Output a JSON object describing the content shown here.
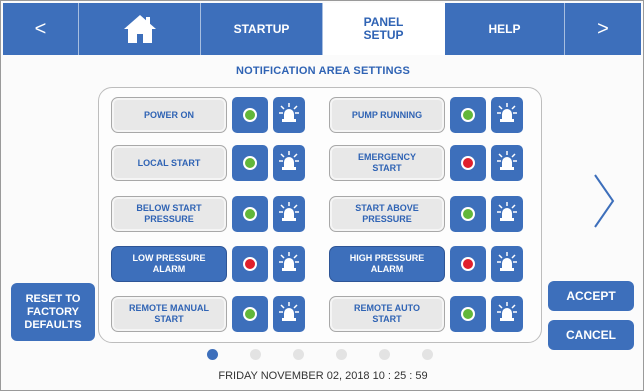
{
  "nav": {
    "back_icon": "chevron-left-icon",
    "back_glyph": "<",
    "home_icon": "home-icon",
    "startup_label": "STARTUP",
    "panel_setup_label": "PANEL\nSETUP",
    "help_label": "HELP",
    "next_icon": "chevron-right-icon",
    "next_glyph": ">"
  },
  "section_title": "NOTIFICATION AREA SETTINGS",
  "rows": [
    {
      "label": "POWER ON",
      "status": "green",
      "style": "normal"
    },
    {
      "label": "PUMP RUNNING",
      "status": "green",
      "style": "normal"
    },
    {
      "label": "LOCAL START",
      "status": "green",
      "style": "normal"
    },
    {
      "label": "EMERGENCY\nSTART",
      "status": "red",
      "style": "normal"
    },
    {
      "label": "BELOW START\nPRESSURE",
      "status": "green",
      "style": "normal"
    },
    {
      "label": "START ABOVE\nPRESSURE",
      "status": "green",
      "style": "normal"
    },
    {
      "label": "LOW PRESSURE\nALARM",
      "status": "red",
      "style": "alarm"
    },
    {
      "label": "HIGH PRESSURE\nALARM",
      "status": "red",
      "style": "alarm"
    },
    {
      "label": "REMOTE MANUAL\nSTART",
      "status": "green",
      "style": "normal"
    },
    {
      "label": "REMOTE AUTO\nSTART",
      "status": "green",
      "style": "normal"
    }
  ],
  "colors": {
    "accent": "#3d6fbb",
    "status_green": "#62b73a",
    "status_red": "#e0202c"
  },
  "buttons": {
    "reset": "RESET TO\nFACTORY\nDEFAULTS",
    "accept": "ACCEPT",
    "cancel": "CANCEL"
  },
  "pager": {
    "pages": 6,
    "active": 1
  },
  "datetime": "FRIDAY NOVEMBER 02, 2018     10 : 25 : 59"
}
